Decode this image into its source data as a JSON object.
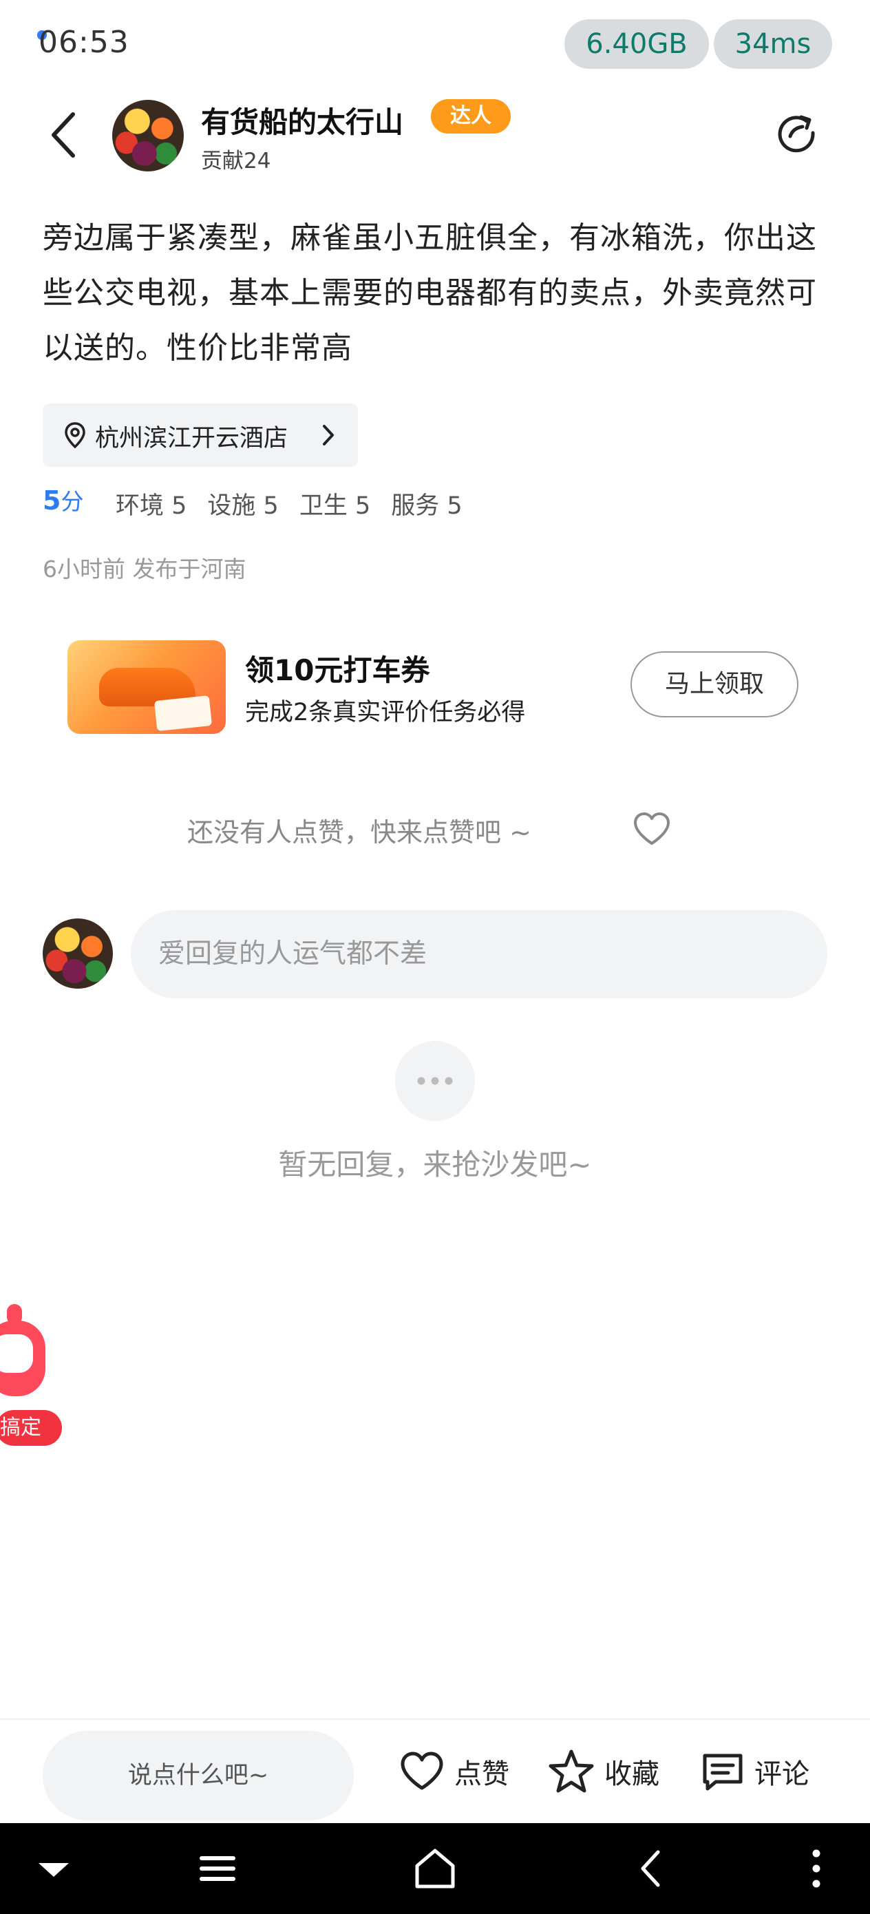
{
  "status_bar": {
    "time": "06:53",
    "memory": "6.40GB",
    "latency": "34ms"
  },
  "header": {
    "user_name": "有货船的太行山",
    "badge": "达人",
    "contribution": "贡献24",
    "back_icon": "chevron-left-icon",
    "share_icon": "share-icon"
  },
  "review": {
    "text": "旁边属于紧凑型，麻雀虽小五脏俱全，有冰箱洗，你出这些公交电视，基本上需要的电器都有的卖点，外卖竟然可以送的。性价比非常高"
  },
  "location": {
    "name": "杭州滨江开云酒店"
  },
  "rating": {
    "score": "5",
    "score_unit": "分",
    "items": [
      "环境 5",
      "设施 5",
      "卫生 5",
      "服务 5"
    ]
  },
  "meta": "6小时前 发布于河南",
  "promo": {
    "title": "领10元打车券",
    "subtitle": "完成2条真实评价任务必得",
    "button": "马上领取"
  },
  "likes": {
    "text": "还没有人点赞，快来点赞吧 ~"
  },
  "reply": {
    "placeholder": "爱回复的人运气都不差"
  },
  "empty_state": {
    "text": "暂无回复，来抢沙发吧~"
  },
  "mascot": {
    "label": "搞定"
  },
  "action_bar": {
    "say_placeholder": "说点什么吧~",
    "like": "点赞",
    "favorite": "收藏",
    "comment": "评论"
  },
  "colors": {
    "accent_blue": "#2f7bf6",
    "badge_orange": "#ff9a1a",
    "pill_text": "#0f7a6a"
  }
}
